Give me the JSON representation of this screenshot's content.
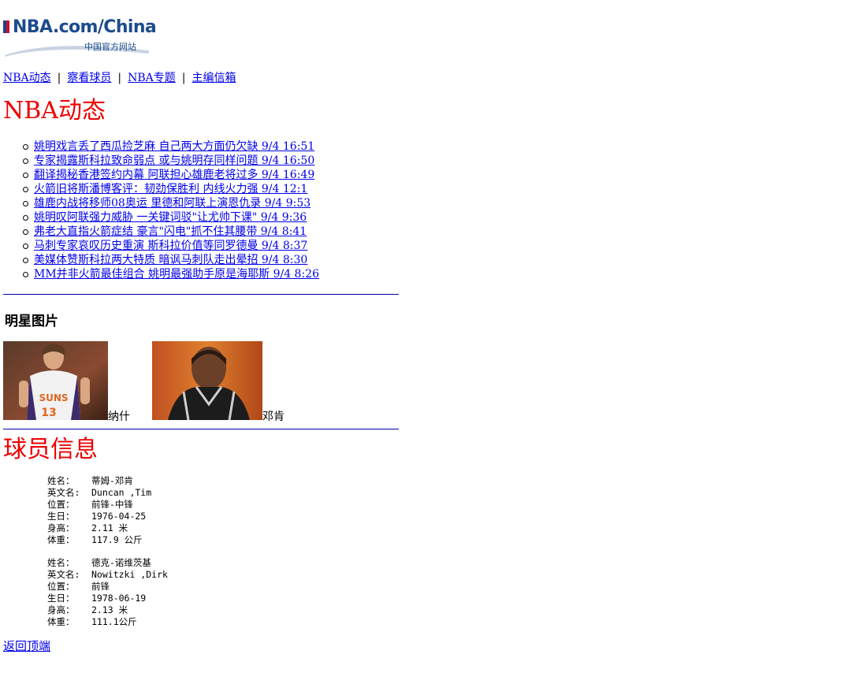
{
  "logo": {
    "text": "NBA.com/China",
    "subtitle": "中国官方网站"
  },
  "nav": {
    "items": [
      "NBA动态",
      "察看球员",
      "NBA专题",
      "主编信箱"
    ]
  },
  "news_section": {
    "title": "NBA动态",
    "items": [
      {
        "text": "姚明戏言丢了西瓜捡芝麻 自己两大方面仍欠缺 9/4 16:51"
      },
      {
        "text": "专家揭露斯科拉致命弱点 或与姚明存同样问题 9/4 16:50"
      },
      {
        "text": "翻译揭秘香港签约内幕 阿联担心雄鹿老将过多 9/4 16:49"
      },
      {
        "text": "火箭旧将斯潘博客评：韧劲保胜利 内线火力强 9/4 12:1"
      },
      {
        "text": "雄鹿内战将移师08奥运 里德和阿联上演恩仇录 9/4 9:53"
      },
      {
        "text": "姚明叹阿联强力威胁 一关键词驳\"让尤帅下课\" 9/4 9:36"
      },
      {
        "text": "弗老大直指火箭症结 豪言\"闪电\"抓不住其腰带 9/4 8:41"
      },
      {
        "text": "马刺专家哀叹历史重演 斯科拉价值等同罗德曼 9/4 8:37"
      },
      {
        "text": "美媒体赞斯科拉两大特质 暗讽马刺队走出晕招 9/4 8:30"
      },
      {
        "text": "MM并非火箭最佳组合 姚明最强助手原是海耶斯 9/4 8:26"
      }
    ]
  },
  "stars": {
    "title": "明星图片",
    "items": [
      {
        "caption": "纳什"
      },
      {
        "caption": "邓肯"
      }
    ]
  },
  "player_section": {
    "title": "球员信息",
    "players": [
      {
        "rows": [
          {
            "label": "姓名：",
            "value": "蒂姆-邓肯"
          },
          {
            "label": "英文名:",
            "value": "Duncan ,Tim"
          },
          {
            "label": "位置：",
            "value": "前锋-中锋"
          },
          {
            "label": "生日：",
            "value": "1976-04-25"
          },
          {
            "label": "身高：",
            "value": "2.11 米"
          },
          {
            "label": "体重：",
            "value": "117.9 公斤"
          }
        ]
      },
      {
        "rows": [
          {
            "label": "姓名：",
            "value": "德克-诺维茨基"
          },
          {
            "label": "英文名:",
            "value": "Nowitzki ,Dirk"
          },
          {
            "label": "位置：",
            "value": "前锋"
          },
          {
            "label": "生日：",
            "value": "1978-06-19"
          },
          {
            "label": "身高：",
            "value": "2.13 米"
          },
          {
            "label": "体重：",
            "value": "111.1公斤"
          }
        ]
      }
    ]
  },
  "back_to_top": "返回顶端"
}
